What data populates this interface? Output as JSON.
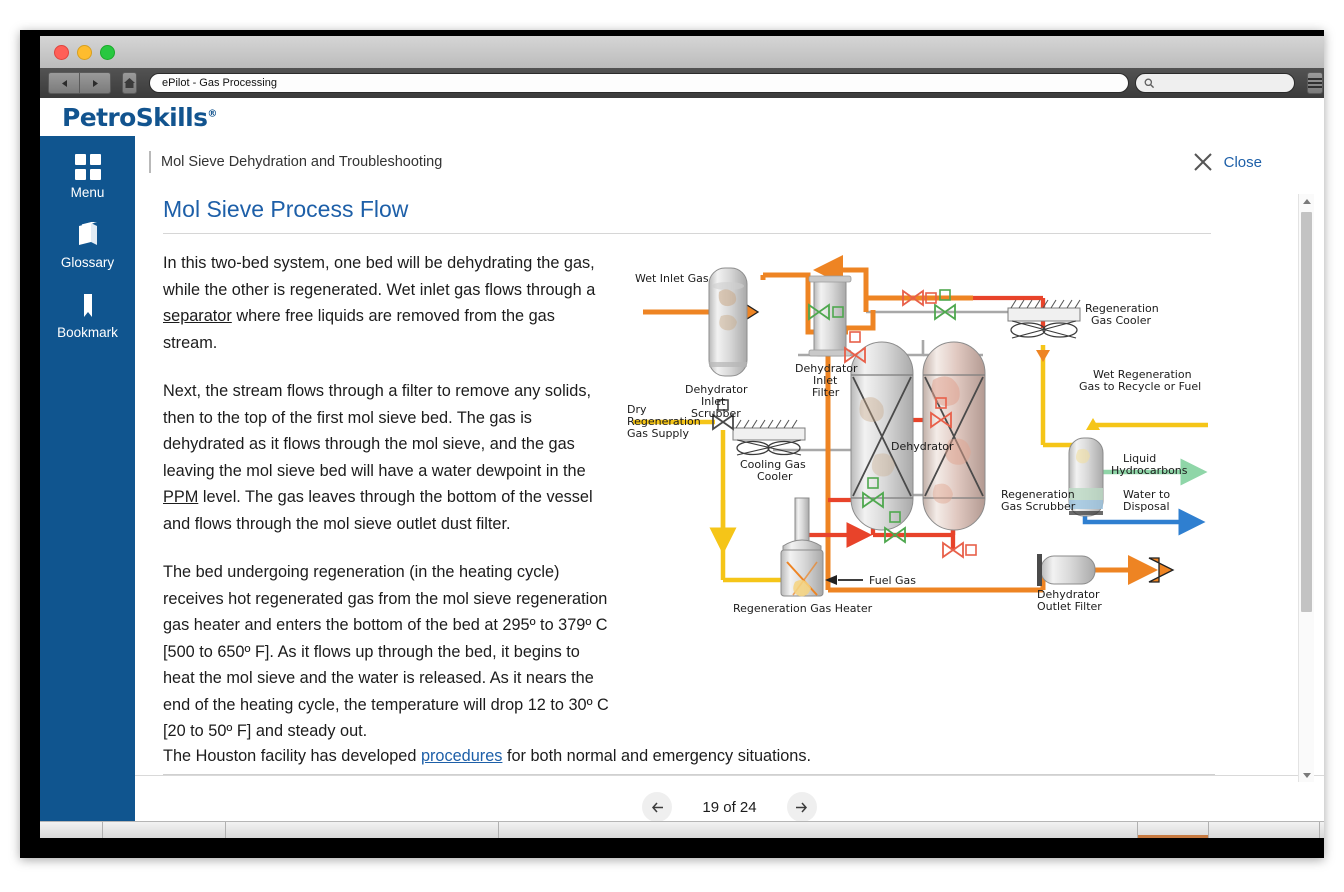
{
  "browser": {
    "title": "ePilot - Gas Processing",
    "back_icon": "back-arrow-icon",
    "forward_icon": "forward-arrow-icon",
    "home_icon": "home-icon",
    "search_placeholder": "",
    "search_icon": "search-icon",
    "menu_icon": "hamburger-menu-icon"
  },
  "brand": {
    "name": "PetroSkills",
    "trademark": "®"
  },
  "sidebar": {
    "items": [
      {
        "label": "Menu",
        "icon": "grid-menu-icon"
      },
      {
        "label": "Glossary",
        "icon": "book-icon"
      },
      {
        "label": "Bookmark",
        "icon": "bookmark-icon"
      }
    ]
  },
  "header": {
    "breadcrumb": "Mol Sieve Dehydration and Troubleshooting",
    "close_label": "Close",
    "close_icon": "close-x-icon"
  },
  "main": {
    "title": "Mol Sieve Process Flow",
    "paragraphs": [
      {
        "parts": [
          {
            "text": "In this two-bed system, one bed will be dehydrating the gas, while the other is regenerated. Wet inlet gas flows through a "
          },
          {
            "text": "separator",
            "link": true
          },
          {
            "text": " where free liquids are removed from the gas stream."
          }
        ]
      },
      {
        "parts": [
          {
            "text": "Next, the stream flows through a filter to remove any solids, then to the top of the first mol sieve bed. The gas is dehydrated as it flows through the mol sieve, and the gas leaving the mol sieve bed will have a water dewpoint in the "
          },
          {
            "text": "PPM",
            "link": true
          },
          {
            "text": " level.  The gas leaves through the bottom of the vessel and flows through the mol sieve outlet dust filter."
          }
        ]
      },
      {
        "parts": [
          {
            "text": "The bed undergoing regeneration (in the heating cycle) receives hot regenerated gas from the mol sieve regeneration gas heater and enters the bottom of the bed at 295º to 379º C [500 to 650º F].  As it flows up through the bed, it begins to heat the mol sieve and the water is released.  As it nears the end of the heating cycle, the temperature will drop 12 to 30º C [20 to 50º F] and steady out."
          }
        ]
      }
    ],
    "closing_line": {
      "before": "The Houston facility has developed ",
      "link": "procedures",
      "after": " for both normal and emergency situations."
    }
  },
  "diagram": {
    "alt": "Mol sieve two-bed dehydration process flow diagram",
    "labels": {
      "wet_inlet_gas": "Wet Inlet Gas",
      "dehydrator_inlet_scrubber": "Dehydrator\nInlet\nScrubber",
      "dehydrator_inlet_filter": "Dehydrator\nInlet\nFilter",
      "dry_regeneration_gas_supply": "Dry\nRegeneration\nGas Supply",
      "cooling_gas_cooler": "Cooling Gas\nCooler",
      "regeneration_gas_heater": "Regeneration Gas Heater",
      "fuel_gas": "Fuel Gas",
      "dehydrator": "Dehydrator",
      "regeneration_gas_cooler": "Regeneration\nGas Cooler",
      "wet_regeneration_gas": "Wet Regeneration\nGas to Recycle or Fuel",
      "liquid_hydrocarbons": "Liquid\nHydrocarbons",
      "regeneration_gas_scrubber": "Regeneration\nGas Scrubber",
      "water_to_disposal": "Water to\nDisposal",
      "dehydrator_outlet_filter": "Dehydrator\nOutlet Filter"
    },
    "colors": {
      "wet_gas_orange": "#ee8423",
      "hot_gas_red": "#e8432a",
      "regen_yellow": "#f5c518",
      "water_blue": "#2f7fd0",
      "hydrocarbon_green": "#8fd6a8",
      "valve_open": "#4fa84f",
      "valve_closed": "#e8604a",
      "pipe_gray": "#a8a8a8"
    }
  },
  "footer": {
    "prev_icon": "left-arrow-icon",
    "next_icon": "right-arrow-icon",
    "page_indicator": "19 of 24"
  },
  "theme": {
    "sidebar_blue": "#10558f",
    "brand_blue": "#12548f",
    "link_blue": "#1d5fa8"
  }
}
